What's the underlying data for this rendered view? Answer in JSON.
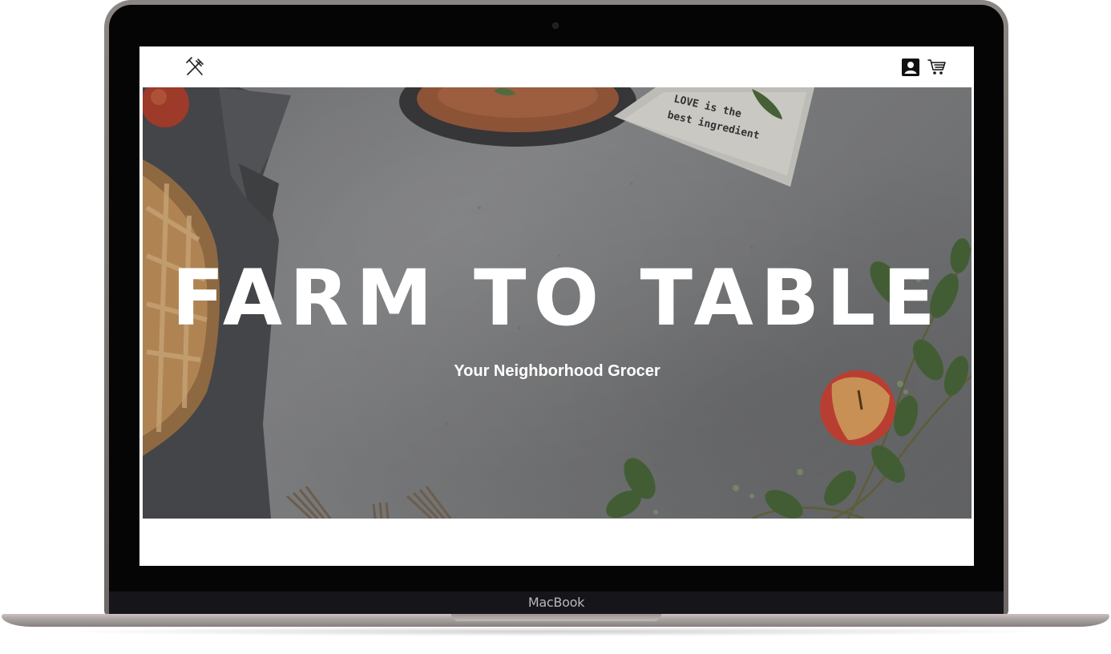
{
  "device": {
    "brand_label": "MacBook"
  },
  "navbar": {
    "logo_icon": "fork-knife-icon",
    "account_icon": "account-icon",
    "cart_icon": "cart-icon"
  },
  "hero": {
    "title": "FARM TO TABLE",
    "subtitle": "Your Neighborhood Grocer",
    "napkin_text_line1": "LOVE is the",
    "napkin_text_line2": "best ingredient"
  },
  "colors": {
    "hero_text": "#ffffff",
    "nav_bg": "#ffffff",
    "bezel": "#050505"
  }
}
